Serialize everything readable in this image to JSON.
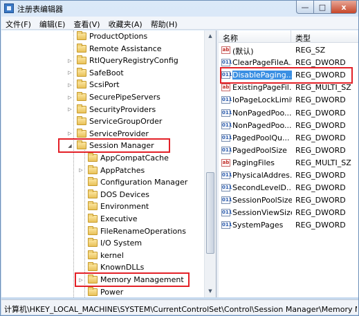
{
  "window": {
    "title": "注册表编辑器",
    "minimize_glyph": "—",
    "maximize_glyph": "□",
    "close_glyph": "x"
  },
  "menubar": {
    "items": [
      "文件(F)",
      "编辑(E)",
      "查看(V)",
      "收藏夹(A)",
      "帮助(H)"
    ]
  },
  "tree": {
    "items": [
      {
        "label": "ProductOptions",
        "level": 1,
        "expander": "",
        "highlighted": false
      },
      {
        "label": "Remote Assistance",
        "level": 1,
        "expander": "",
        "highlighted": false
      },
      {
        "label": "RtlQueryRegistryConfig",
        "level": 1,
        "expander": "▷",
        "highlighted": false
      },
      {
        "label": "SafeBoot",
        "level": 1,
        "expander": "▷",
        "highlighted": false
      },
      {
        "label": "ScsiPort",
        "level": 1,
        "expander": "▷",
        "highlighted": false
      },
      {
        "label": "SecurePipeServers",
        "level": 1,
        "expander": "▷",
        "highlighted": false
      },
      {
        "label": "SecurityProviders",
        "level": 1,
        "expander": "▷",
        "highlighted": false
      },
      {
        "label": "ServiceGroupOrder",
        "level": 1,
        "expander": "",
        "highlighted": false
      },
      {
        "label": "ServiceProvider",
        "level": 1,
        "expander": "▷",
        "highlighted": false
      },
      {
        "label": "Session Manager",
        "level": 1,
        "expander": "◢",
        "highlighted": true
      },
      {
        "label": "AppCompatCache",
        "level": 2,
        "expander": "",
        "highlighted": false
      },
      {
        "label": "AppPatches",
        "level": 2,
        "expander": "▷",
        "highlighted": false
      },
      {
        "label": "Configuration Manager",
        "level": 2,
        "expander": "",
        "highlighted": false
      },
      {
        "label": "DOS Devices",
        "level": 2,
        "expander": "",
        "highlighted": false
      },
      {
        "label": "Environment",
        "level": 2,
        "expander": "",
        "highlighted": false
      },
      {
        "label": "Executive",
        "level": 2,
        "expander": "",
        "highlighted": false
      },
      {
        "label": "FileRenameOperations",
        "level": 2,
        "expander": "",
        "highlighted": false
      },
      {
        "label": "I/O System",
        "level": 2,
        "expander": "",
        "highlighted": false
      },
      {
        "label": "kernel",
        "level": 2,
        "expander": "",
        "highlighted": false
      },
      {
        "label": "KnownDLLs",
        "level": 2,
        "expander": "",
        "highlighted": false
      },
      {
        "label": "Memory Management",
        "level": 2,
        "expander": "▷",
        "highlighted": true
      },
      {
        "label": "Power",
        "level": 2,
        "expander": "",
        "highlighted": false
      }
    ]
  },
  "tree_scrollbar": {
    "up_glyph": "▲",
    "down_glyph": "▼"
  },
  "list": {
    "header": {
      "name": "名称",
      "type": "类型"
    },
    "rows": [
      {
        "icon": "ab",
        "name": "(默认)",
        "type": "REG_SZ",
        "selected": false
      },
      {
        "icon": "bin",
        "name": "ClearPageFileA...",
        "type": "REG_DWORD",
        "selected": false
      },
      {
        "icon": "bin",
        "name": "DisablePaging...",
        "type": "REG_DWORD",
        "selected": true
      },
      {
        "icon": "ab",
        "name": "ExistingPageFil...",
        "type": "REG_MULTI_SZ",
        "selected": false
      },
      {
        "icon": "bin",
        "name": "IoPageLockLimit",
        "type": "REG_DWORD",
        "selected": false
      },
      {
        "icon": "bin",
        "name": "NonPagedPoo...",
        "type": "REG_DWORD",
        "selected": false
      },
      {
        "icon": "bin",
        "name": "NonPagedPoo...",
        "type": "REG_DWORD",
        "selected": false
      },
      {
        "icon": "bin",
        "name": "PagedPoolQu...",
        "type": "REG_DWORD",
        "selected": false
      },
      {
        "icon": "bin",
        "name": "PagedPoolSize",
        "type": "REG_DWORD",
        "selected": false
      },
      {
        "icon": "ab",
        "name": "PagingFiles",
        "type": "REG_MULTI_SZ",
        "selected": false
      },
      {
        "icon": "bin",
        "name": "PhysicalAddres...",
        "type": "REG_DWORD",
        "selected": false
      },
      {
        "icon": "bin",
        "name": "SecondLevelD...",
        "type": "REG_DWORD",
        "selected": false
      },
      {
        "icon": "bin",
        "name": "SessionPoolSize",
        "type": "REG_DWORD",
        "selected": false
      },
      {
        "icon": "bin",
        "name": "SessionViewSize",
        "type": "REG_DWORD",
        "selected": false
      },
      {
        "icon": "bin",
        "name": "SystemPages",
        "type": "REG_DWORD",
        "selected": false
      }
    ]
  },
  "statusbar": {
    "path": "计算机\\HKEY_LOCAL_MACHINE\\SYSTEM\\CurrentControlSet\\Control\\Session Manager\\Memory M"
  },
  "colors": {
    "highlight_box": "#e32027",
    "selection": "#3a8fe3"
  }
}
